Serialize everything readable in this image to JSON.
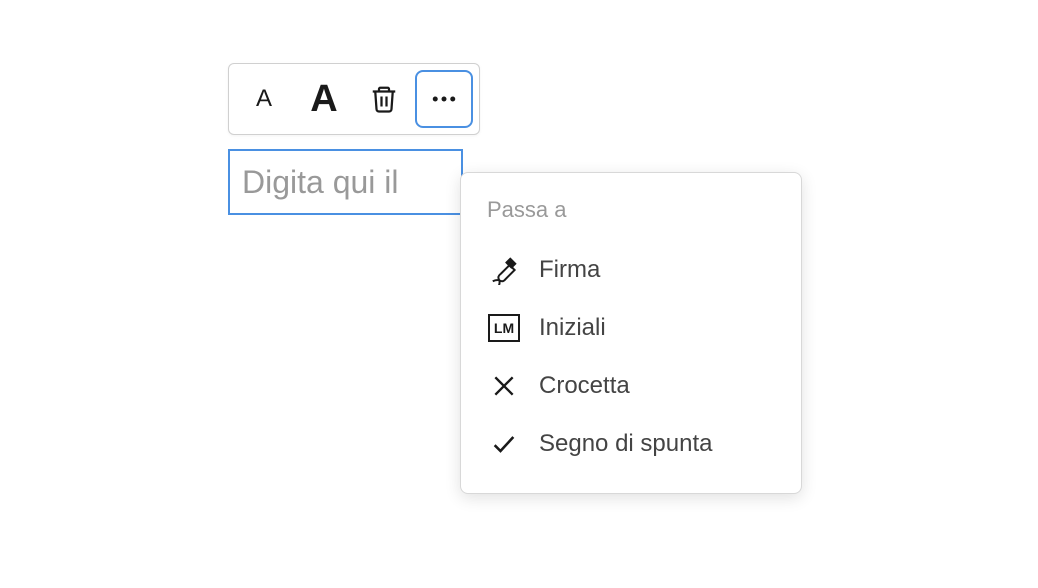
{
  "toolbar": {
    "small_a_label": "A",
    "big_a_label": "A"
  },
  "input": {
    "placeholder": "Digita qui il"
  },
  "dropdown": {
    "heading": "Passa a",
    "items": [
      {
        "label": "Firma",
        "icon": "pen-nib-icon"
      },
      {
        "label": "Iniziali",
        "icon": "initials-icon",
        "initials": "LM"
      },
      {
        "label": "Crocetta",
        "icon": "x-mark-icon"
      },
      {
        "label": "Segno di spunta",
        "icon": "check-icon"
      }
    ]
  }
}
